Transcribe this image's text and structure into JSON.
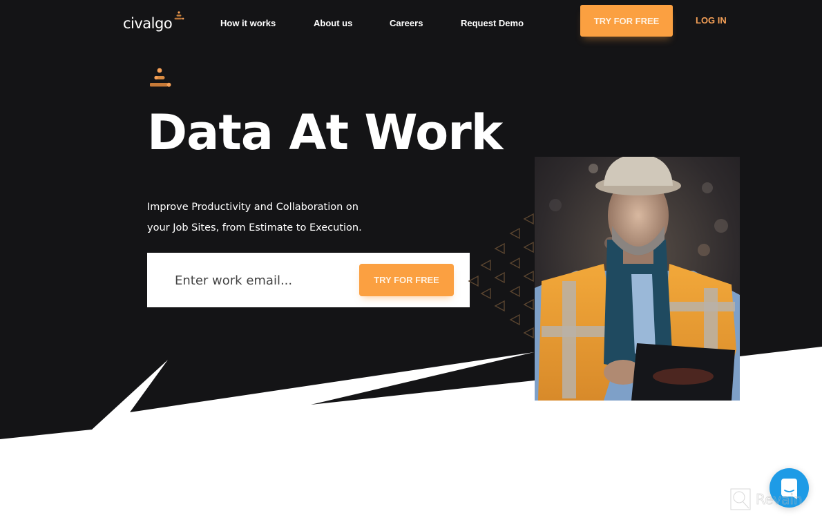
{
  "brand": {
    "name": "civalgo",
    "accent_color": "#fba041",
    "background_color": "#141416"
  },
  "nav": {
    "links": [
      {
        "label": "How it works"
      },
      {
        "label": "About us"
      },
      {
        "label": "Careers"
      },
      {
        "label": "Request Demo"
      }
    ],
    "cta_label": "TRY FOR FREE",
    "login_label": "LOG IN"
  },
  "hero": {
    "icon": "pyramid-dots-icon",
    "title": "Data At Work",
    "subtitle_line1": "Improve Productivity and Collaboration on",
    "subtitle_line2": "your Job Sites, from Estimate to Execution.",
    "email_placeholder": "Enter work email...",
    "email_value": "",
    "cta_label": "TRY FOR FREE",
    "image_description": "Construction worker in hard hat and high-visibility vest using a tablet"
  },
  "chat": {
    "icon": "chat-bubble-icon",
    "color": "#1e9be6"
  },
  "watermark": {
    "text": "Revain"
  }
}
